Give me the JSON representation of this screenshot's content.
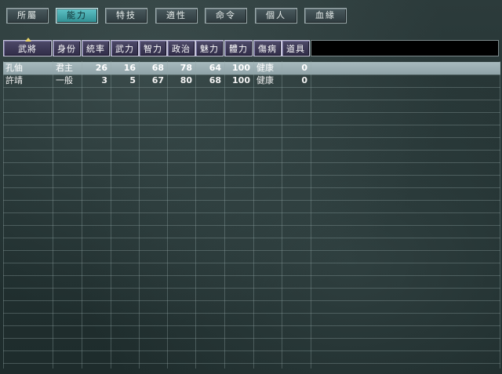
{
  "tabs": [
    {
      "label": "所屬",
      "active": false
    },
    {
      "label": "能力",
      "active": true
    },
    {
      "label": "特技",
      "active": false
    },
    {
      "label": "適性",
      "active": false
    },
    {
      "label": "命令",
      "active": false
    },
    {
      "label": "個人",
      "active": false
    },
    {
      "label": "血緣",
      "active": false
    }
  ],
  "table": {
    "columns": [
      "武將",
      "身份",
      "統率",
      "武力",
      "智力",
      "政治",
      "魅力",
      "體力",
      "傷病",
      "道具"
    ],
    "sorted_column": "武將",
    "rows": [
      {
        "name": "孔伷",
        "rank": "君主",
        "lead": "26",
        "war": "16",
        "int": "68",
        "pol": "78",
        "chr": "64",
        "hp": "100",
        "health": "健康",
        "items": "0",
        "selected": true
      },
      {
        "name": "許靖",
        "rank": "一般",
        "lead": "3",
        "war": "5",
        "int": "67",
        "pol": "80",
        "chr": "68",
        "hp": "100",
        "health": "健康",
        "items": "0",
        "selected": false
      }
    ]
  },
  "colors": {
    "active_tab": "#3fa9ad",
    "header_cell": "#3a3655",
    "selected_row": "#9eb1b5"
  }
}
